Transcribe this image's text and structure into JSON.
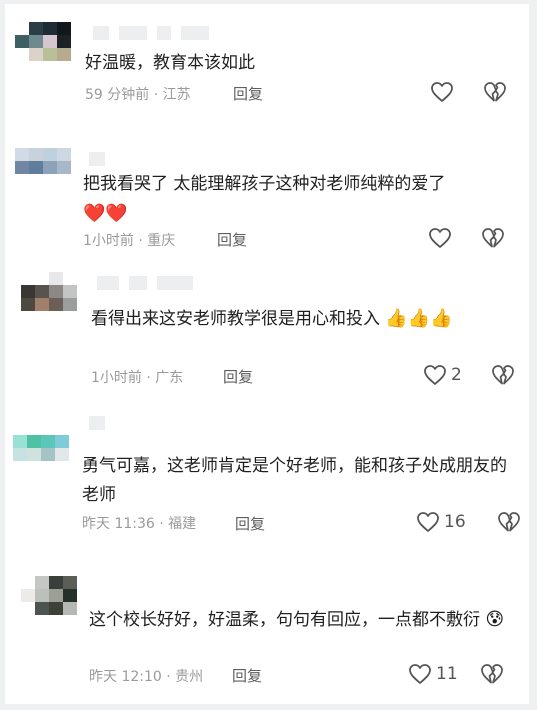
{
  "comments": [
    {
      "text": "好温暖，教育本该如此",
      "emojis": "",
      "time": "59 分钟前 · 江苏",
      "reply_label": "回复",
      "likes": "",
      "avatar_colors": [
        "#ffffff",
        "#2d3d45",
        "#1e2d35",
        "#11181c",
        "#3e5f63",
        "#6e8a8f",
        "#d6c6cf",
        "#1a2226",
        "#ffffff",
        "#dcd2c9",
        "#b9bf97",
        "#b7ab8f",
        "#ffffff",
        "#ffffff",
        "#ffffff",
        "#ffffff"
      ]
    },
    {
      "text": "把我看哭了 太能理解孩子这种对老师纯粹的爱了",
      "emojis": "❤️❤️",
      "time": "1小时前 · 重庆",
      "reply_label": "回复",
      "likes": "",
      "avatar_colors": [
        "#d2dbe5",
        "#c7d2dd",
        "#bfd0df",
        "#cdd8e3",
        "#6f87a3",
        "#5f7e9d",
        "#8ba2b8",
        "#a8b8c8",
        "#ffffff",
        "#ffffff",
        "#ffffff",
        "#ffffff",
        "#ffffff",
        "#ffffff",
        "#ffffff",
        "#ffffff"
      ]
    },
    {
      "text": "看得出来这安老师教学很是用心和投入",
      "emojis": "👍👍👍",
      "time": "1小时前 · 广东",
      "reply_label": "回复",
      "likes": "2",
      "avatar_colors": [
        "#ffffff",
        "#ffffff",
        "#e8e8ea",
        "#ffffff",
        "#3a3634",
        "#5a524d",
        "#8d8884",
        "#c3c4c4",
        "#4e4843",
        "#a27f6a",
        "#6b5f58",
        "#9a9c9e",
        "#ffffff",
        "#ffffff",
        "#ffffff",
        "#ffffff"
      ]
    },
    {
      "text": "勇气可嘉，这老师肯定是个好老师，能和孩子处成朋友的老师",
      "emojis": "",
      "time": "昨天 11:36 · 福建",
      "reply_label": "回复",
      "likes": "16",
      "avatar_colors": [
        "#ffffff",
        "#ffffff",
        "#ffffff",
        "#ffffff",
        "#9be0d5",
        "#4fc2a5",
        "#5ec6b9",
        "#7fcbd7",
        "#c7e2e3",
        "#cfe2dd",
        "#a3c3c4",
        "#e0e8ea",
        "#ffffff",
        "#ffffff",
        "#ffffff",
        "#ffffff"
      ]
    },
    {
      "text": "这个校长好好，好温柔，句句有回应，一点都不敷衍",
      "emojis": "😰",
      "time": "昨天 12:10 · 贵州",
      "reply_label": "回复",
      "likes": "11",
      "avatar_colors": [
        "#ffffff",
        "#c4c7c4",
        "#3b3f3b",
        "#5b5e56",
        "#ecebe8",
        "#bcbfba",
        "#9ba094",
        "#25302b",
        "#ffffff",
        "#4c544f",
        "#3c4039",
        "#b6b8b2",
        "#ffffff",
        "#ffffff",
        "#ffffff",
        "#ffffff"
      ]
    }
  ]
}
